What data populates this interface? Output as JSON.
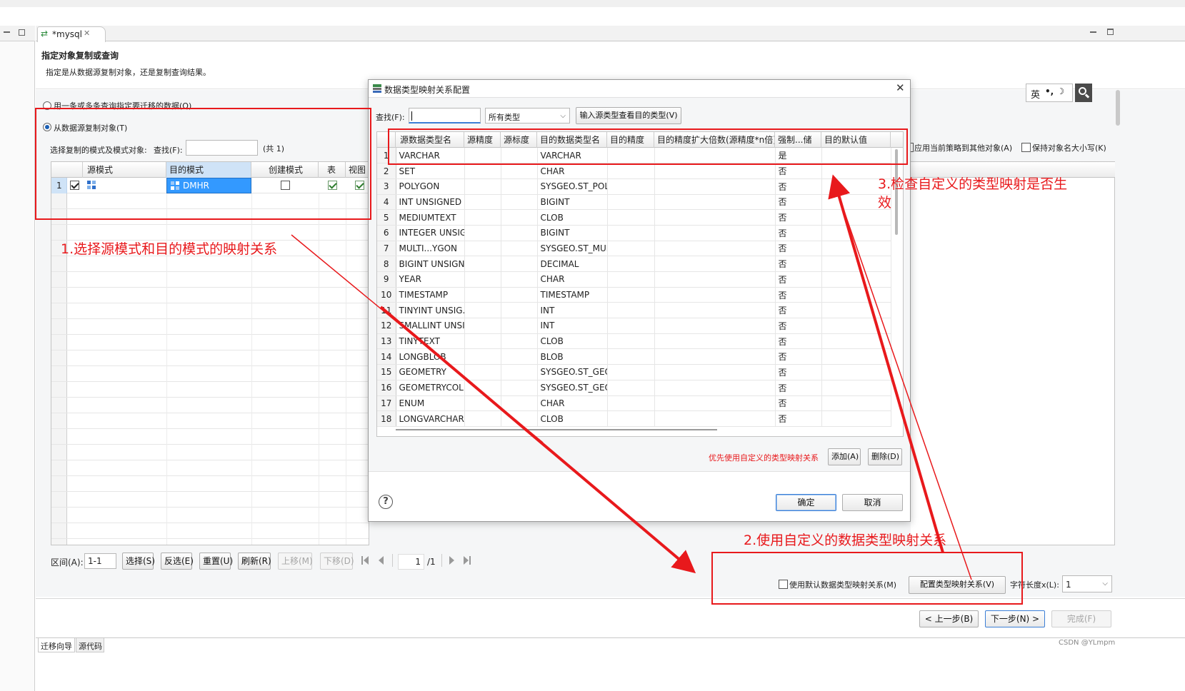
{
  "editor_tab": {
    "title": "*mysql"
  },
  "wizard": {
    "title": "指定对象复制或查询",
    "subtitle": "指定是从数据源复制对象，还是复制查询结果。",
    "option_query": "用一条或多条查询指定要迁移的数据(Q)",
    "option_copy": "从数据源复制对象(T)",
    "select_label": "选择复制的模式及模式对象:",
    "find_label": "查找(F):",
    "count_label": "(共 1)",
    "grid_headers": [
      "源模式",
      "目的模式",
      "创建模式",
      "表",
      "视图"
    ],
    "grid_row": {
      "index": "1",
      "target": "DMHR"
    },
    "range_label": "区间(A):",
    "range_value": "1-1",
    "buttons": [
      "选择(S)",
      "反选(E)",
      "重置(U)",
      "刷新(R)",
      "上移(M)",
      "下移(D)"
    ],
    "page_current": "1",
    "page_total": "/1",
    "apply_policy": "应用当前策略到其他对象(A)",
    "keep_case": "保持对象名大小写(K)",
    "use_default_mapping": "使用默认数据类型映射关系(M)",
    "config_mapping_btn": "配置类型映射关系(V)",
    "char_length_label": "字符长度x(L):",
    "char_length_value": "1",
    "prev_btn": "< 上一步(B)",
    "next_btn": "下一步(N) >",
    "finish_btn": "完成(F)",
    "bottom_tabs": [
      "迁移向导",
      "源代码"
    ]
  },
  "ime": {
    "lang": "英",
    "symbols": "•, ☽"
  },
  "dialog": {
    "title": "数据类型映射关系配置",
    "find_label": "查找(F):",
    "type_filter": "所有类型",
    "lookup_btn": "输入源类型查看目的类型(V)",
    "columns": [
      "源数据类型名",
      "源精度",
      "源标度",
      "目的数据类型名",
      "目的精度",
      "目的精度扩大倍数(源精度*n倍)",
      "强制...储",
      "目的默认值"
    ],
    "rows": [
      [
        "1",
        "VARCHAR",
        "VARCHAR",
        "是"
      ],
      [
        "2",
        "SET",
        "CHAR",
        "否"
      ],
      [
        "3",
        "POLYGON",
        "SYSGEO.ST_POL.",
        "否"
      ],
      [
        "4",
        "INT UNSIGNED",
        "BIGINT",
        "否"
      ],
      [
        "5",
        "MEDIUMTEXT",
        "CLOB",
        "否"
      ],
      [
        "6",
        "INTEGER UNSIG",
        "BIGINT",
        "否"
      ],
      [
        "7",
        "MULTI...YGON",
        "SYSGEO.ST_MUL",
        "否"
      ],
      [
        "8",
        "BIGINT UNSIGN",
        "DECIMAL",
        "否"
      ],
      [
        "9",
        "YEAR",
        "CHAR",
        "否"
      ],
      [
        "10",
        "TIMESTAMP",
        "TIMESTAMP",
        "否"
      ],
      [
        "11",
        "TINYINT UNSIG.",
        "INT",
        "否"
      ],
      [
        "12",
        "SMALLINT UNSI",
        "INT",
        "否"
      ],
      [
        "13",
        "TINYTEXT",
        "CLOB",
        "否"
      ],
      [
        "14",
        "LONGBLOB",
        "BLOB",
        "否"
      ],
      [
        "15",
        "GEOMETRY",
        "SYSGEO.ST_GEO",
        "否"
      ],
      [
        "16",
        "GEOMETRYCOLL",
        "SYSGEO.ST_GEO",
        "否"
      ],
      [
        "17",
        "ENUM",
        "CHAR",
        "否"
      ],
      [
        "18",
        "LONGVARCHAR",
        "CLOB",
        "否"
      ]
    ],
    "priority_note": "优先使用自定义的类型映射关系",
    "add_btn": "添加(A)",
    "delete_btn": "删除(D)",
    "ok_btn": "确定",
    "cancel_btn": "取消"
  },
  "annotations": {
    "step1": "1.选择源模式和目的模式的映射关系",
    "step2": "2.使用自定义的数据类型映射关系",
    "step3_line1": "3.检查自定义的类型映射是否生",
    "step3_line2": "效"
  },
  "watermark": "CSDN @YLmpm",
  "colors": {
    "annotation_red": "#e8191c",
    "selection_blue": "#3399ff",
    "dialog_primary_border": "#3c7fd6"
  }
}
